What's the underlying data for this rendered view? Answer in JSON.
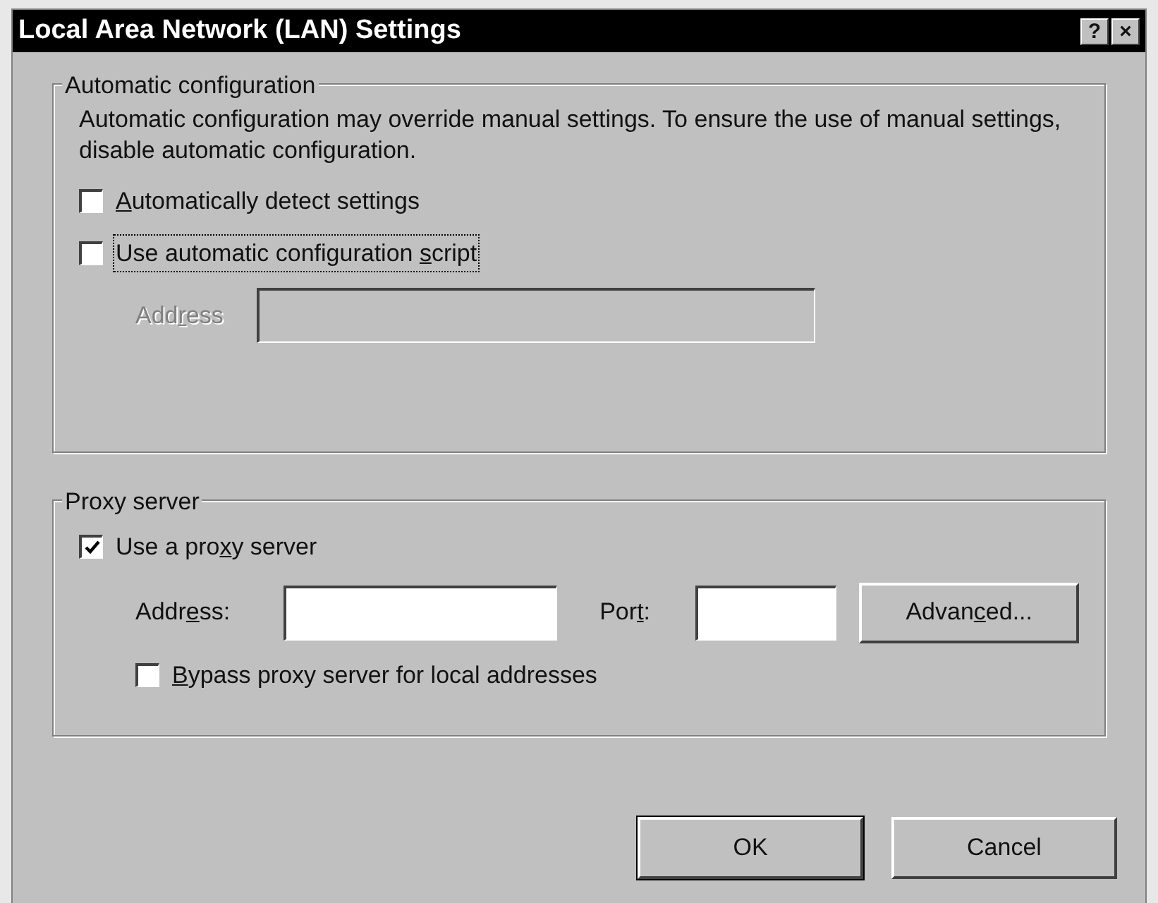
{
  "window": {
    "title": "Local Area Network (LAN) Settings",
    "title_buttons": [
      "?",
      "×"
    ]
  },
  "automatic_configuration": {
    "legend": "Automatic configuration",
    "description": "Automatic configuration may override manual settings.  To ensure the use of manual settings, disable automatic configuration.",
    "checkboxes": [
      {
        "key": "A",
        "post": "utomatically detect settings",
        "checked": false,
        "focused": false
      },
      {
        "pre": "Use automatic configuration ",
        "key": "s",
        "post": "cript",
        "checked": false,
        "focused": true
      }
    ],
    "address": {
      "pre": "Add",
      "key": "r",
      "post": "ess",
      "disabled": true
    }
  },
  "proxy_server": {
    "legend": "Proxy server",
    "use_proxy": {
      "pre": "Use a pro",
      "key": "x",
      "post": "y server",
      "checked": true,
      "focused": false
    },
    "address": {
      "pre": "Addr",
      "key": "e",
      "post": "ss:",
      "disabled": false
    },
    "port": {
      "pre": "Por",
      "key": "t",
      "post": ":",
      "disabled": false
    },
    "advanced_button": {
      "pre": "Advan",
      "key": "c",
      "post": "ed..."
    },
    "bypass": {
      "key": "B",
      "post": "ypass proxy server for local addresses",
      "checked": false,
      "focused": false
    }
  },
  "buttons": [
    {
      "label": "OK",
      "default": true
    },
    {
      "label": "Cancel",
      "default": false
    }
  ]
}
